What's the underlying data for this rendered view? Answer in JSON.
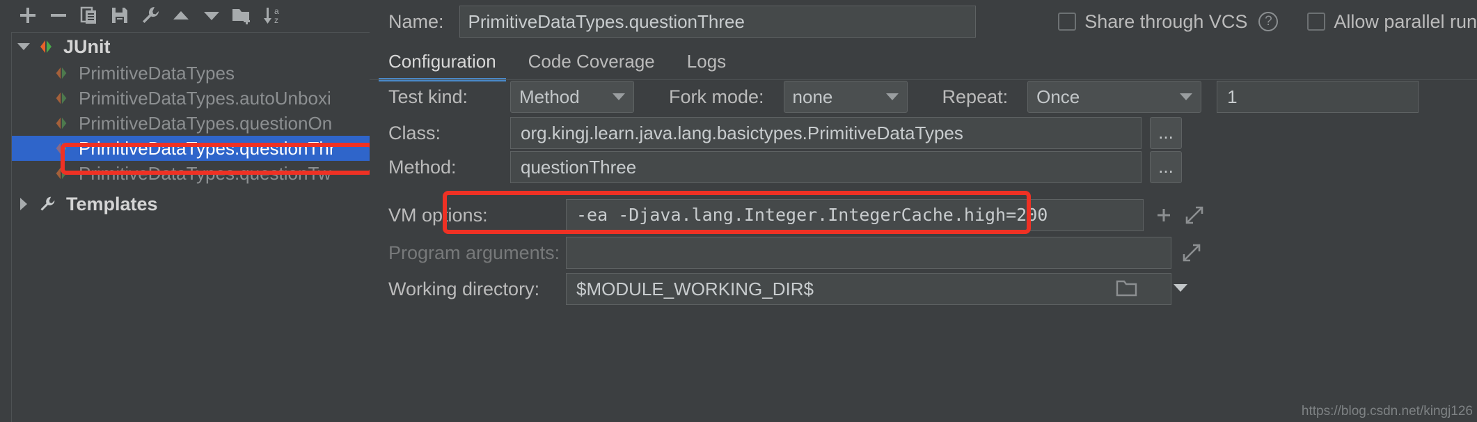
{
  "toolbar": {
    "buttons": [
      {
        "name": "add-configuration-button",
        "icon": "plus-icon",
        "title": "Add New Configuration"
      },
      {
        "name": "remove-configuration-button",
        "icon": "minus-icon",
        "title": "Remove Configuration"
      },
      {
        "name": "copy-configuration-button",
        "icon": "copy-icon",
        "title": "Copy Configuration"
      },
      {
        "name": "save-configuration-button",
        "icon": "save-icon",
        "title": "Save Configuration"
      },
      {
        "name": "edit-templates-button",
        "icon": "wrench-icon",
        "title": "Edit Templates"
      },
      {
        "name": "move-up-button",
        "icon": "arrow-up-icon",
        "title": "Move Up"
      },
      {
        "name": "move-down-button",
        "icon": "arrow-down-icon",
        "title": "Move Down"
      },
      {
        "name": "new-folder-button",
        "icon": "new-folder-icon",
        "title": "Create New Folder"
      },
      {
        "name": "sort-configurations-button",
        "icon": "sort-alpha-icon",
        "title": "Sort Configurations"
      }
    ]
  },
  "tree": {
    "root": {
      "label": "JUnit",
      "expanded": true,
      "icon": "junit-icon"
    },
    "items": [
      {
        "label": "PrimitiveDataTypes",
        "selected": false,
        "icon": "junit-icon"
      },
      {
        "label": "PrimitiveDataTypes.autoUnboxi",
        "selected": false,
        "icon": "junit-icon"
      },
      {
        "label": "PrimitiveDataTypes.questionOn",
        "selected": false,
        "icon": "junit-icon"
      },
      {
        "label": "PrimitiveDataTypes.questionThr",
        "selected": true,
        "icon": "junit-icon"
      },
      {
        "label": "PrimitiveDataTypes.questionTw",
        "selected": false,
        "icon": "junit-icon"
      }
    ],
    "templates": {
      "label": "Templates",
      "expanded": false,
      "icon": "wrench-icon"
    }
  },
  "header": {
    "name_label": "Name:",
    "name_value": "PrimitiveDataTypes.questionThree",
    "share_vcs_label": "Share through VCS",
    "share_vcs_checked": false,
    "help_glyph": "?",
    "allow_parallel_label": "Allow parallel run",
    "allow_parallel_checked": false
  },
  "tabs": [
    {
      "label": "Configuration",
      "active": true
    },
    {
      "label": "Code Coverage",
      "active": false
    },
    {
      "label": "Logs",
      "active": false
    }
  ],
  "form": {
    "test_kind_label": "Test kind:",
    "test_kind_value": "Method",
    "fork_mode_label": "Fork mode:",
    "fork_mode_value": "none",
    "repeat_label": "Repeat:",
    "repeat_value": "Once",
    "repeat_count_value": "1",
    "class_label": "Class:",
    "class_value": "org.kingj.learn.java.lang.basictypes.PrimitiveDataTypes",
    "class_browse_label": "...",
    "method_label": "Method:",
    "method_value": "questionThree",
    "method_browse_label": "...",
    "vm_options_label": "VM options:",
    "vm_options_value": "-ea -Djava.lang.Integer.IntegerCache.high=200",
    "program_arguments_label": "Program arguments:",
    "program_arguments_value": "",
    "working_directory_label": "Working directory:",
    "working_directory_value": "$MODULE_WORKING_DIR$"
  },
  "annotations": {
    "highlight_color": "#ef3124",
    "selection_color": "#2f65ca",
    "accent_color": "#4a88c7"
  },
  "watermark": "https://blog.csdn.net/kingj126"
}
